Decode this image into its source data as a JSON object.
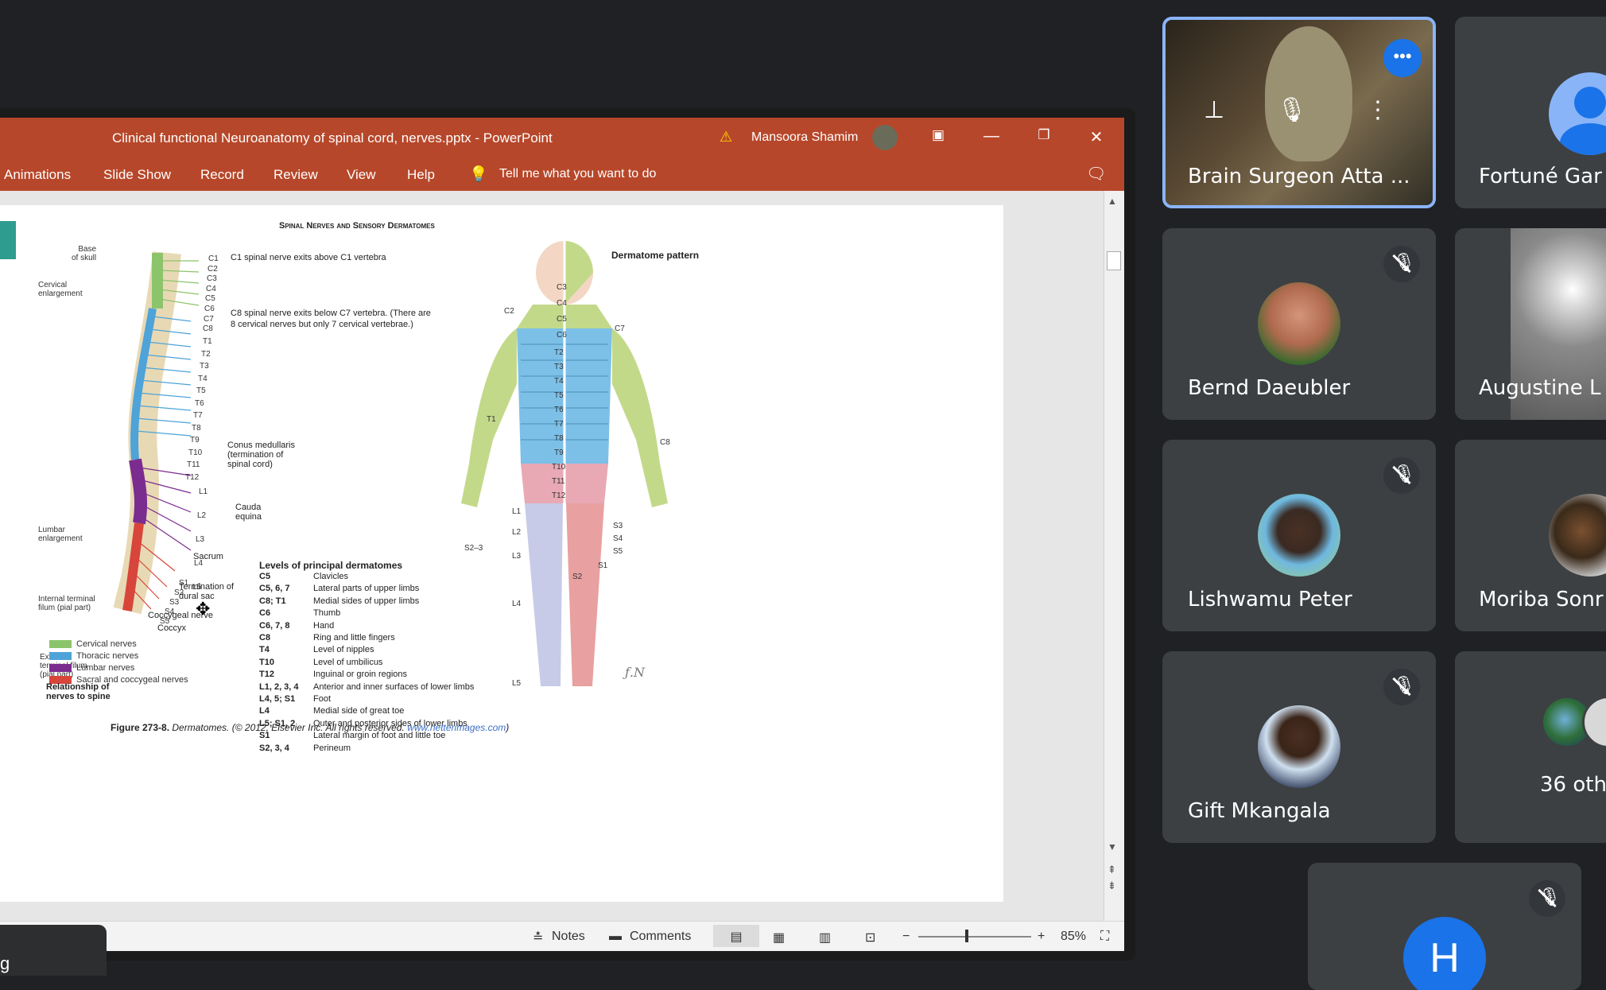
{
  "window": {
    "title": "Clinical functional Neuroanatomy of spinal cord, nerves.pptx  -  PowerPoint",
    "user": "Mansoora Shamim"
  },
  "ribbon": {
    "tabs": [
      "Animations",
      "Slide Show",
      "Record",
      "Review",
      "View",
      "Help"
    ],
    "tell_me": "Tell me what you want to do"
  },
  "status_bar": {
    "notes": "Notes",
    "comments": "Comments",
    "zoom": "85%"
  },
  "slide": {
    "title": "Spinal Nerves and Sensory Dermatomes",
    "dermatome_title": "Dermatome pattern",
    "left_labels": {
      "base_of_skull": [
        "Base",
        "of skull"
      ],
      "cervical_enlargement": [
        "Cervical",
        "enlargement"
      ],
      "lumbar_enlargement": [
        "Lumbar",
        "enlargement"
      ],
      "internal_terminal": [
        "Internal terminal",
        "filum (pial part)"
      ],
      "external_terminal": [
        "External",
        "terminal filum",
        "(pial part)"
      ]
    },
    "notes": {
      "c1": "C1 spinal nerve exits above C1 vertebra",
      "c8_line1": "C8 spinal nerve exits below C7 vertebra. (There are",
      "c8_line2": "8 cervical nerves but only 7 cervical vertebrae.)",
      "conus_1": "Conus medullaris",
      "conus_2": "(termination of",
      "conus_3": "spinal cord)",
      "cauda_1": "Cauda",
      "cauda_2": "equina",
      "sacrum": "Sacrum",
      "termination_1": "Termination of",
      "termination_2": "dural sac",
      "coccygeal_nerve": "Coccygeal nerve",
      "coccyx": "Coccyx"
    },
    "spine_labels_right": [
      "C1",
      "C2",
      "C3",
      "C4",
      "C5",
      "C6",
      "C7",
      "C8",
      "T1",
      "T2",
      "T3",
      "T4",
      "T5",
      "T6",
      "T7",
      "T8",
      "T9",
      "T10",
      "T11",
      "T12",
      "L1",
      "L2",
      "L3",
      "L4",
      "L5",
      "S1",
      "S2",
      "S3",
      "S4",
      "S5"
    ],
    "legend": [
      {
        "label": "Cervical nerves",
        "color": "#8cc46b"
      },
      {
        "label": "Thoracic nerves",
        "color": "#4ea3d8"
      },
      {
        "label": "Lumbar nerves",
        "color": "#7b2c8f"
      },
      {
        "label": "Sacral and coccygeal nerves",
        "color": "#d8453a"
      }
    ],
    "legend_caption": [
      "Relationship of",
      "nerves to spine"
    ],
    "levels_title": "Levels of principal dermatomes",
    "levels": [
      [
        "C5",
        "Clavicles"
      ],
      [
        "C5, 6, 7",
        "Lateral parts of upper limbs"
      ],
      [
        "C8; T1",
        "Medial sides of upper limbs"
      ],
      [
        "C6",
        "Thumb"
      ],
      [
        "C6, 7, 8",
        "Hand"
      ],
      [
        "C8",
        "Ring and little fingers"
      ],
      [
        "T4",
        "Level of nipples"
      ],
      [
        "T10",
        "Level of umbilicus"
      ],
      [
        "T12",
        "Inguinal or groin regions"
      ],
      [
        "L1, 2, 3, 4",
        "Anterior and inner surfaces of lower limbs"
      ],
      [
        "L4, 5; S1",
        "Foot"
      ],
      [
        "L4",
        "Medial side of great toe"
      ],
      [
        "L5; S1, 2",
        "Outer and posterior sides of lower limbs"
      ],
      [
        "S1",
        "Lateral margin of foot and little toe"
      ],
      [
        "S2, 3, 4",
        "Perineum"
      ]
    ],
    "caption_bold": "Figure 273-8.",
    "caption_text": " Dermatomes. (© 2012, Elsevier Inc. All rights reserved. ",
    "caption_link": "www.netterimages.com",
    "caption_end": ")",
    "body_labels": [
      "C2",
      "C3",
      "C4",
      "C5",
      "C6",
      "C7",
      "C8",
      "T1",
      "T2",
      "T3",
      "T4",
      "T5",
      "T6",
      "T7",
      "T8",
      "T9",
      "T10",
      "T11",
      "T12",
      "L1",
      "L2",
      "L3",
      "L4",
      "L5",
      "S1",
      "S2",
      "S3",
      "S4",
      "S5",
      "S2–3"
    ]
  },
  "participants": [
    {
      "name": "Brain Surgeon Atta ...",
      "active": true
    },
    {
      "name": "Fortuné Gar"
    },
    {
      "name": "Bernd Daeubler",
      "muted": true
    },
    {
      "name": "Augustine L"
    },
    {
      "name": "Lishwamu Peter",
      "muted": true
    },
    {
      "name": "Moriba Sonr"
    },
    {
      "name": "Gift Mkangala",
      "muted": true
    },
    {
      "name": "36 oth"
    },
    {
      "name": "H",
      "muted": true
    }
  ],
  "taskbar_fragment": "g"
}
